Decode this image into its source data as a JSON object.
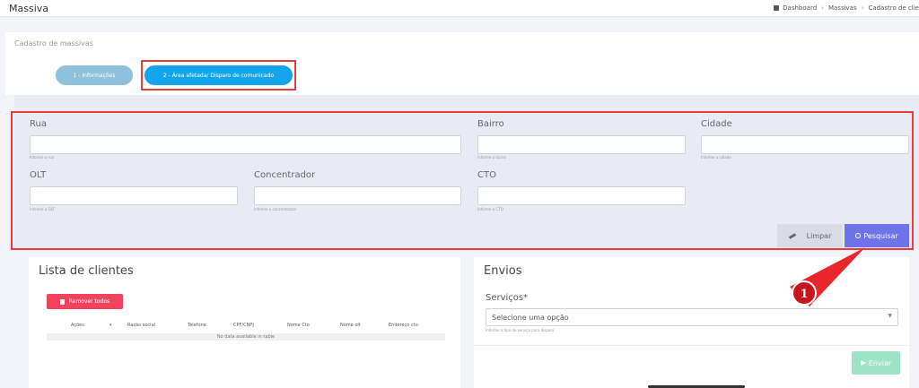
{
  "header": {
    "title": "Massiva",
    "breadcrumb": [
      "Dashboard",
      "Massivas",
      "Cadastro de clie"
    ]
  },
  "form": {
    "title": "Cadastro de massivas",
    "steps": [
      {
        "label": "1 - Informações"
      },
      {
        "label": "2 - Área afetada/ Disparo de comunicado"
      }
    ]
  },
  "filters": {
    "rua": {
      "label": "Rua",
      "help": "Informe a rua"
    },
    "bairro": {
      "label": "Bairro",
      "help": "Informe o bairro"
    },
    "cidade": {
      "label": "Cidade",
      "help": "Informe a cidade"
    },
    "olt": {
      "label": "OLT",
      "help": "Informe a OLT"
    },
    "concentrador": {
      "label": "Concentrador",
      "help": "Informe o concentrador"
    },
    "cto": {
      "label": "CTO",
      "help": "Informe a CTO"
    },
    "clear_label": "Limpar",
    "search_label": "Pesquisar"
  },
  "clients": {
    "title": "Lista de clientes",
    "remove_all_label": "Remover todos",
    "columns": [
      "Ações",
      "Razão social",
      "Telefone",
      "CPF/CNPJ",
      "Nome Cto",
      "Nome olt",
      "Endereço cto"
    ],
    "empty_text": "No data available in table"
  },
  "envios": {
    "title": "Envios",
    "services_label": "Serviços*",
    "select_placeholder": "Selecione uma opção",
    "services_help": "Informe o tipo de serviço para disparo",
    "send_label": "Enviar"
  },
  "callout": {
    "number": "1"
  },
  "colors": {
    "primary": "#6f73ea",
    "step_active": "#12a5ec",
    "step_inactive": "#8fc1dc",
    "danger": "#f1435e",
    "success": "#9de4c7",
    "highlight": "#ea3a3a"
  }
}
